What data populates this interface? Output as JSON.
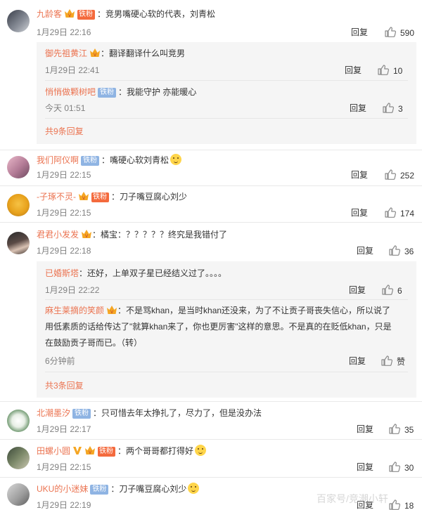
{
  "comments": [
    {
      "user": "九龄客",
      "badge": "铁粉",
      "text": "：竞男嘴硬心软的代表，刘青松",
      "time": "1月29日 22:16",
      "reply": "回复",
      "likes": "590",
      "sub_replies": [
        {
          "user": "御先祖黄江",
          "text": "：翻译翻译什么叫竞男",
          "time": "1月29日 22:41",
          "reply": "回复",
          "likes": "10"
        },
        {
          "user": "悄悄做颗树吧",
          "badge": "铁粉",
          "text": "：我能守护 亦能暖心",
          "time": "今天 01:51",
          "reply": "回复",
          "likes": "3"
        }
      ],
      "more_replies": "共9条回复"
    },
    {
      "user": "我们阿仪啊",
      "badge": "铁粉",
      "text": "：嘴硬心软刘青松",
      "time": "1月29日 22:15",
      "reply": "回复",
      "likes": "252"
    },
    {
      "user": "-子琢不灵-",
      "badge": "铁粉",
      "text": "：刀子嘴豆腐心刘少",
      "time": "1月29日 22:15",
      "reply": "回复",
      "likes": "174"
    },
    {
      "user": "君君小发发",
      "text": "：橘宝：？？？？？终究是我错付了",
      "time": "1月29日 22:18",
      "reply": "回复",
      "likes": "36",
      "sub_replies": [
        {
          "user": "已婚斯塔",
          "text": "：还好，上单双子星已经结义过了。。。。",
          "time": "1月29日 22:22",
          "reply": "回复",
          "likes": "6"
        },
        {
          "user": "麻生莱摘的笑颜",
          "text_lines": [
            "：不是骂khan，是当时khan还没来，为了不让贡子哥丧失信心，所以说了",
            "用低素质的话给传达了\"就算khan来了，你也更厉害\"这样的意思。不是真的在贬低khan，只是",
            "在鼓励贡子哥而已。（转）"
          ],
          "time": "6分钟前",
          "reply": "回复",
          "likes": "赞"
        }
      ],
      "more_replies": "共3条回复"
    },
    {
      "user": "北潮墨汐",
      "badge": "铁粉",
      "text": "：只可惜去年太挣扎了，尽力了，但是没办法",
      "time": "1月29日 22:17",
      "reply": "回复",
      "likes": "35"
    },
    {
      "user": "田螺小圆",
      "badge": "铁粉",
      "text": "：两个哥哥都打得好",
      "time": "1月29日 22:15",
      "reply": "回复",
      "likes": "30"
    },
    {
      "user": "UKU的小迷妹",
      "badge": "铁粉",
      "text": "：刀子嘴豆腐心刘少",
      "time": "1月29日 22:19",
      "reply": "回复",
      "likes": "18"
    }
  ],
  "watermark": "百家号/竞潮小轩",
  "colors": {
    "username": "#eb7350",
    "badge_fan": "#8fb4e3",
    "badge_gold": "#f46a3d",
    "time": "#808080",
    "sub_bg": "#f5f5f5"
  }
}
